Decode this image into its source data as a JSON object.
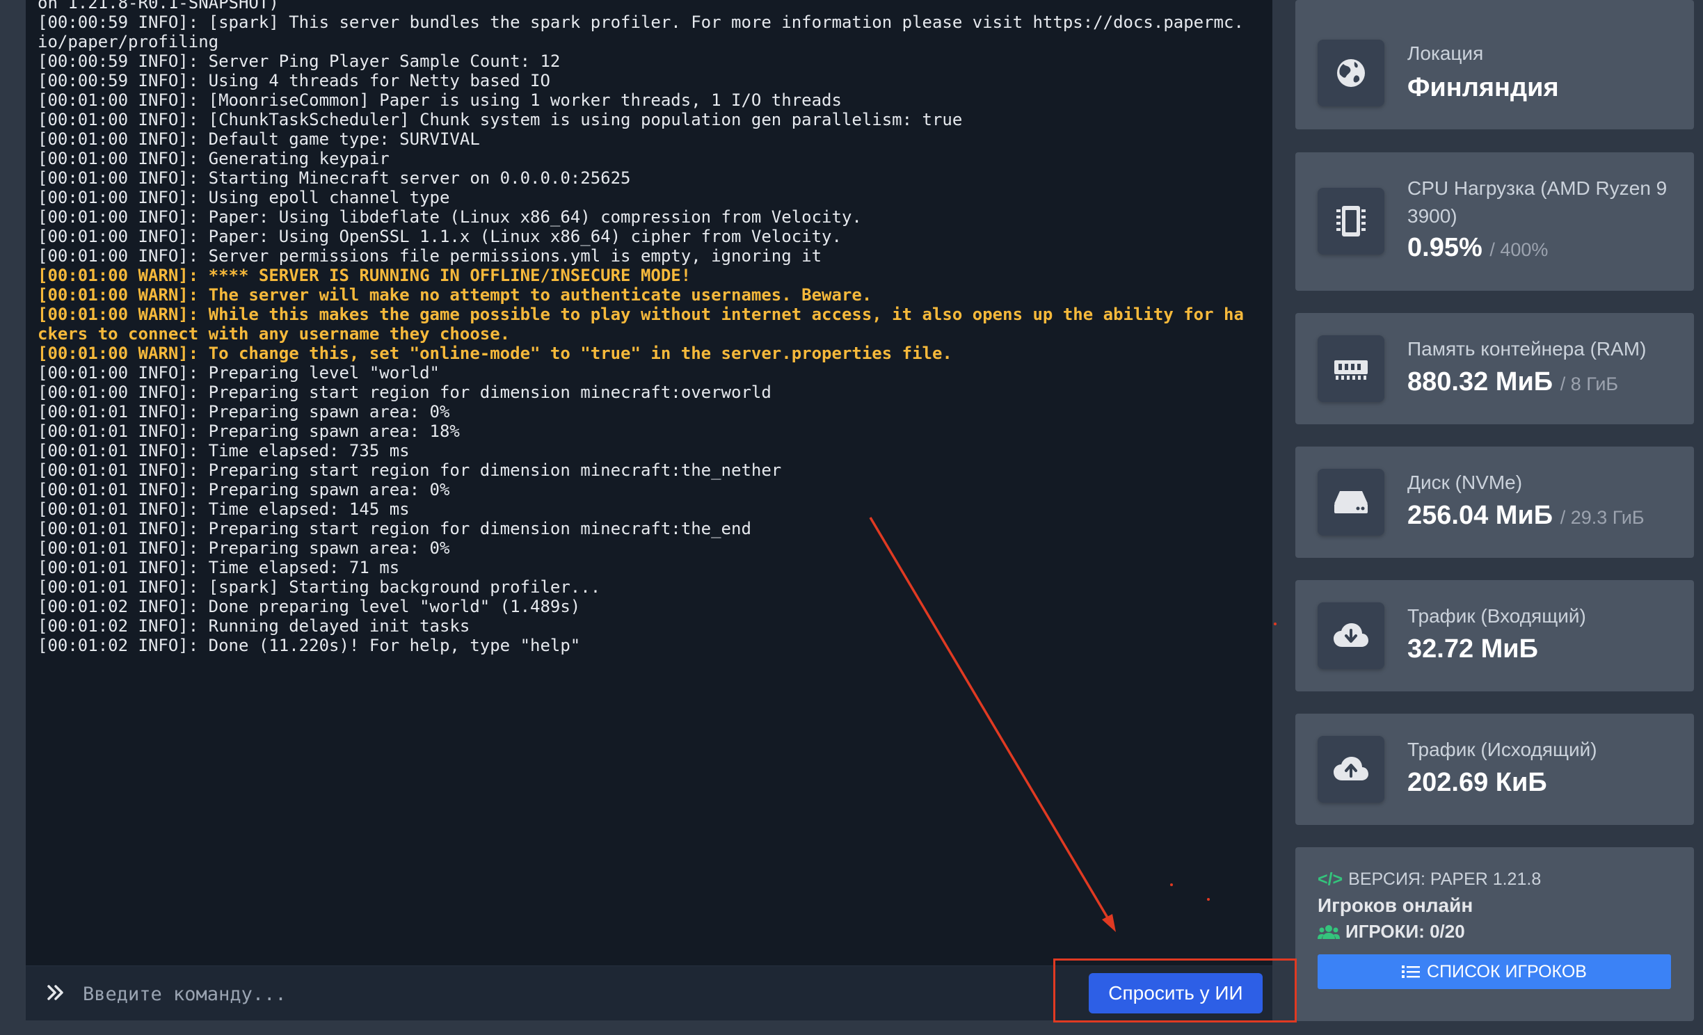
{
  "console": {
    "lines": [
      {
        "text": "on 1.21.8-R0.1-SNAPSHOT)",
        "level": "info"
      },
      {
        "text": "[00:00:59 INFO]: [spark] This server bundles the spark profiler. For more information please visit https://docs.papermc.io/paper/profiling",
        "level": "info"
      },
      {
        "text": "[00:00:59 INFO]: Server Ping Player Sample Count: 12",
        "level": "info"
      },
      {
        "text": "[00:00:59 INFO]: Using 4 threads for Netty based IO",
        "level": "info"
      },
      {
        "text": "[00:01:00 INFO]: [MoonriseCommon] Paper is using 1 worker threads, 1 I/O threads",
        "level": "info"
      },
      {
        "text": "[00:01:00 INFO]: [ChunkTaskScheduler] Chunk system is using population gen parallelism: true",
        "level": "info"
      },
      {
        "text": "[00:01:00 INFO]: Default game type: SURVIVAL",
        "level": "info"
      },
      {
        "text": "[00:01:00 INFO]: Generating keypair",
        "level": "info"
      },
      {
        "text": "[00:01:00 INFO]: Starting Minecraft server on 0.0.0.0:25625",
        "level": "info"
      },
      {
        "text": "[00:01:00 INFO]: Using epoll channel type",
        "level": "info"
      },
      {
        "text": "[00:01:00 INFO]: Paper: Using libdeflate (Linux x86_64) compression from Velocity.",
        "level": "info"
      },
      {
        "text": "[00:01:00 INFO]: Paper: Using OpenSSL 1.1.x (Linux x86_64) cipher from Velocity.",
        "level": "info"
      },
      {
        "text": "[00:01:00 INFO]: Server permissions file permissions.yml is empty, ignoring it",
        "level": "info"
      },
      {
        "text": "[00:01:00 WARN]: **** SERVER IS RUNNING IN OFFLINE/INSECURE MODE!",
        "level": "warn"
      },
      {
        "text": "[00:01:00 WARN]: The server will make no attempt to authenticate usernames. Beware.",
        "level": "warn"
      },
      {
        "text": "[00:01:00 WARN]: While this makes the game possible to play without internet access, it also opens up the ability for hackers to connect with any username they choose.",
        "level": "warn"
      },
      {
        "text": "[00:01:00 WARN]: To change this, set \"online-mode\" to \"true\" in the server.properties file.",
        "level": "warn"
      },
      {
        "text": "[00:01:00 INFO]: Preparing level \"world\"",
        "level": "info"
      },
      {
        "text": "[00:01:00 INFO]: Preparing start region for dimension minecraft:overworld",
        "level": "info"
      },
      {
        "text": "[00:01:01 INFO]: Preparing spawn area: 0%",
        "level": "info"
      },
      {
        "text": "[00:01:01 INFO]: Preparing spawn area: 18%",
        "level": "info"
      },
      {
        "text": "[00:01:01 INFO]: Time elapsed: 735 ms",
        "level": "info"
      },
      {
        "text": "[00:01:01 INFO]: Preparing start region for dimension minecraft:the_nether",
        "level": "info"
      },
      {
        "text": "[00:01:01 INFO]: Preparing spawn area: 0%",
        "level": "info"
      },
      {
        "text": "[00:01:01 INFO]: Time elapsed: 145 ms",
        "level": "info"
      },
      {
        "text": "[00:01:01 INFO]: Preparing start region for dimension minecraft:the_end",
        "level": "info"
      },
      {
        "text": "[00:01:01 INFO]: Preparing spawn area: 0%",
        "level": "info"
      },
      {
        "text": "[00:01:01 INFO]: Time elapsed: 71 ms",
        "level": "info"
      },
      {
        "text": "[00:01:01 INFO]: [spark] Starting background profiler...",
        "level": "info"
      },
      {
        "text": "[00:01:02 INFO]: Done preparing level \"world\" (1.489s)",
        "level": "info"
      },
      {
        "text": "[00:01:02 INFO]: Running delayed init tasks",
        "level": "info"
      },
      {
        "text": "[00:01:02 INFO]: Done (11.220s)! For help, type \"help\"",
        "level": "info"
      }
    ],
    "command_placeholder": "Введите команду...",
    "ask_ai_label": "Спросить у ИИ"
  },
  "stats": {
    "location": {
      "label": "Локация",
      "value": "Финляндия",
      "icon": "globe-icon"
    },
    "cpu": {
      "label": "CPU Нагрузка (AMD Ryzen 9 3900)",
      "value": "0.95%",
      "limit": "/ 400%",
      "icon": "cpu-icon"
    },
    "ram": {
      "label": "Память контейнера (RAM)",
      "value": "880.32 МиБ",
      "limit": "/ 8 ГиБ",
      "icon": "memory-icon"
    },
    "disk": {
      "label": "Диск (NVMe)",
      "value": "256.04 МиБ",
      "limit": "/ 29.3 ГиБ",
      "icon": "hard-drive-icon"
    },
    "traffic_in": {
      "label": "Трафик (Входящий)",
      "value": "32.72 МиБ",
      "icon": "cloud-download-icon"
    },
    "traffic_out": {
      "label": "Трафик (Исходящий)",
      "value": "202.69 КиБ",
      "icon": "cloud-upload-icon"
    }
  },
  "server_info": {
    "version": "ВЕРСИЯ: PAPER 1.21.8",
    "online_title": "Игроков онлайн",
    "players": "ИГРОКИ: 0/20",
    "player_list_label": "СПИСОК ИГРОКОВ"
  },
  "colors": {
    "accent_blue": "#2d5fe6",
    "warn": "#f6b93b",
    "annotation": "#e03a22",
    "version_green": "#34c47c"
  }
}
